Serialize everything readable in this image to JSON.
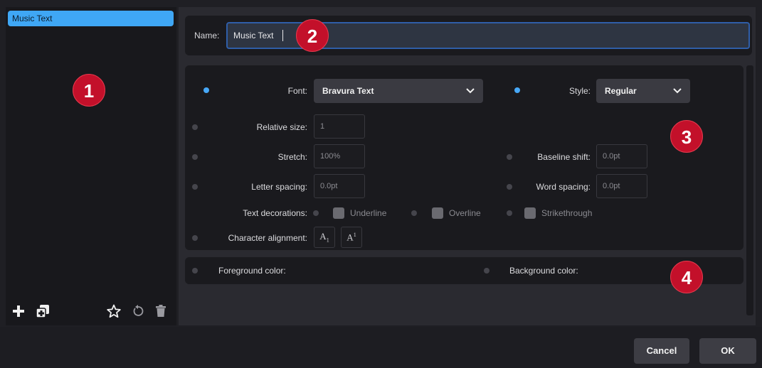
{
  "left_panel": {
    "items": [
      {
        "label": "Music Text",
        "selected": true
      }
    ],
    "toolbar": {
      "add_icon": "plus-icon",
      "duplicate_icon": "duplicate-icon",
      "favorite_icon": "star-icon",
      "revert_icon": "revert-icon",
      "delete_icon": "trash-icon"
    }
  },
  "name_row": {
    "label": "Name:",
    "value": "Music Text"
  },
  "properties": {
    "font": {
      "label": "Font:",
      "value": "Bravura Text",
      "enabled": true
    },
    "style": {
      "label": "Style:",
      "value": "Regular",
      "enabled": true
    },
    "relative_size": {
      "label": "Relative size:",
      "value": "1",
      "enabled": false
    },
    "stretch": {
      "label": "Stretch:",
      "value": "100%",
      "enabled": false
    },
    "baseline_shift": {
      "label": "Baseline shift:",
      "value": "0.0pt",
      "enabled": false
    },
    "letter_spacing": {
      "label": "Letter spacing:",
      "value": "0.0pt",
      "enabled": false
    },
    "word_spacing": {
      "label": "Word spacing:",
      "value": "0.0pt",
      "enabled": false
    },
    "text_decorations": {
      "label": "Text decorations:",
      "options": [
        {
          "label": "Underline",
          "enabled": false,
          "checked": false
        },
        {
          "label": "Overline",
          "enabled": false,
          "checked": false
        },
        {
          "label": "Strikethrough",
          "enabled": false,
          "checked": false
        }
      ]
    },
    "character_alignment": {
      "label": "Character alignment:",
      "enabled": false
    }
  },
  "colors": {
    "foreground": {
      "label": "Foreground color:",
      "enabled": false
    },
    "background": {
      "label": "Background color:",
      "enabled": false
    }
  },
  "callouts": [
    "1",
    "2",
    "3",
    "4"
  ],
  "buttons": {
    "cancel": "Cancel",
    "ok": "OK"
  },
  "theme": {
    "accent": "#47a8f7",
    "selection": "#3fa7f5",
    "callout": "#c3102a"
  }
}
